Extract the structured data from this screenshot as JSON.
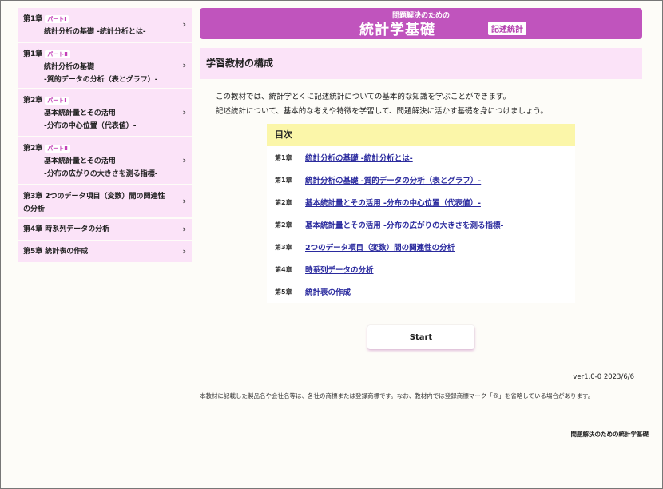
{
  "sidebar": {
    "items": [
      {
        "chapter": "第1章",
        "part": "パートⅠ",
        "line1": "統計分析の基礎 -統計分析とは-",
        "line2": ""
      },
      {
        "chapter": "第1章",
        "part": "パートⅡ",
        "line1": "統計分析の基礎",
        "line2": "-質的データの分析（表とグラフ）-"
      },
      {
        "chapter": "第2章",
        "part": "パートⅠ",
        "line1": "基本統計量とその活用",
        "line2": "-分布の中心位置（代表値）-"
      },
      {
        "chapter": "第2章",
        "part": "パートⅡ",
        "line1": "基本統計量とその活用",
        "line2": "-分布の広がりの大きさを測る指標-"
      },
      {
        "chapter": "第3章",
        "title": "2つのデータ項目（変数）間の関連性の分析"
      },
      {
        "chapter": "第4章",
        "title": "時系列データの分析"
      },
      {
        "chapter": "第5章",
        "title": "統計表の作成"
      }
    ],
    "chevron": "›"
  },
  "banner": {
    "top": "問題解決のための",
    "title": "統計学基礎",
    "tag": "記述統計"
  },
  "section": {
    "title": "学習教材の構成"
  },
  "intro": {
    "line1": "この教材では、統計学とくに記述統計についての基本的な知識を学ぶことができます。",
    "line2": "記述統計について、基本的な考えや特徴を学習して、問題解決に活かす基礎を身につけましょう。"
  },
  "toc": {
    "heading": "目次",
    "rows": [
      {
        "chapter": "第1章",
        "label": "統計分析の基礎 -統計分析とは-"
      },
      {
        "chapter": "第1章",
        "label": "統計分析の基礎 -質的データの分析（表とグラフ）-"
      },
      {
        "chapter": "第2章",
        "label": "基本統計量とその活用 -分布の中心位置（代表値）-"
      },
      {
        "chapter": "第2章",
        "label": "基本統計量とその活用 -分布の広がりの大きさを測る指標-"
      },
      {
        "chapter": "第3章",
        "label": "2つのデータ項目（変数）間の関連性の分析"
      },
      {
        "chapter": "第4章",
        "label": "時系列データの分析"
      },
      {
        "chapter": "第5章",
        "label": "統計表の作成"
      }
    ]
  },
  "start_label": "Start",
  "version": "ver1.0-0 2023/6/6",
  "notice": "本教材に記載した製品名や会社名等は、各社の商標または登録商標です。なお、教材内では登録商標マーク「®」を省略している場合があります。",
  "footer": "問題解決のための統計学基礎",
  "colors": {
    "accent": "#c054bd",
    "sidebar_bg": "#fbe3f8",
    "toc_head_bg": "#fbf6a9",
    "link": "#2a2a9e"
  }
}
